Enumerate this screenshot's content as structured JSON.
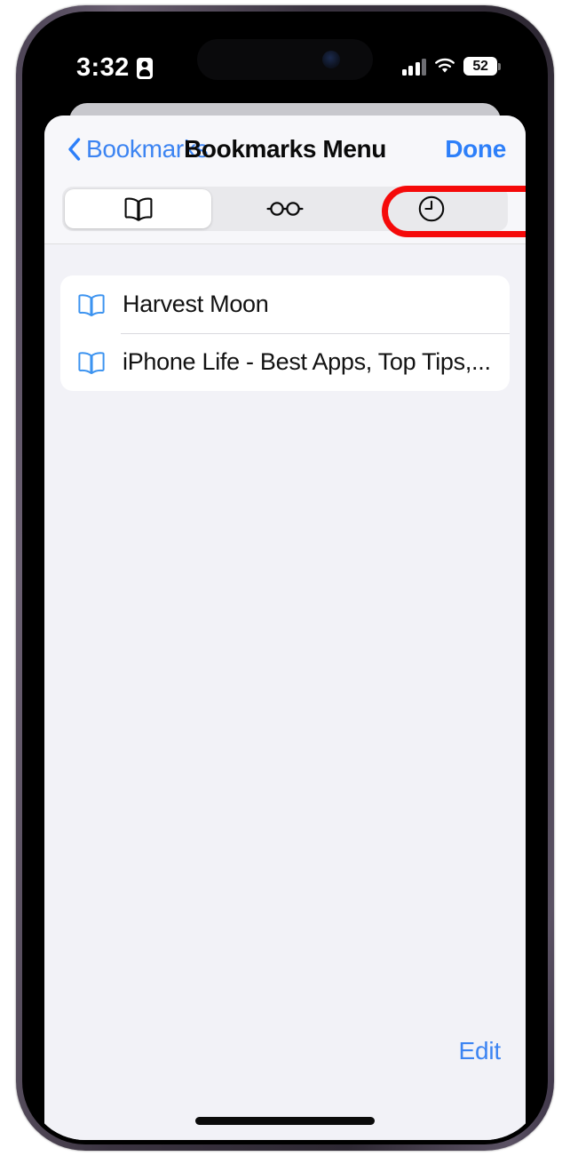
{
  "status_bar": {
    "time": "3:32",
    "privacy_icon": "person-id-icon",
    "cellular_icon": "cellular-bars-icon",
    "wifi_icon": "wifi-icon",
    "battery_percent": "52"
  },
  "nav": {
    "back_icon": "chevron-left-icon",
    "back_label": "Bookmarks",
    "title": "Bookmarks Menu",
    "done_label": "Done"
  },
  "segments": [
    {
      "icon": "book-icon",
      "name": "bookmarks",
      "selected": true
    },
    {
      "icon": "reading-glasses-icon",
      "name": "reading-list",
      "selected": false
    },
    {
      "icon": "clock-icon",
      "name": "history",
      "selected": false
    }
  ],
  "annotation": {
    "shape": "oval",
    "color": "#f50a0a",
    "target": "history-segment"
  },
  "bookmarks": [
    {
      "icon": "book-icon",
      "title": "Harvest Moon"
    },
    {
      "icon": "book-icon",
      "title": "iPhone Life - Best Apps, Top Tips,..."
    }
  ],
  "toolbar": {
    "edit_label": "Edit"
  },
  "colors": {
    "accent_blue": "#2d7ff9",
    "link_blue": "#3c84f2",
    "annotation_red": "#f50a0a",
    "grouped_background": "#f2f2f7",
    "card_white": "#ffffff",
    "segment_track": "#e9e9ec"
  }
}
